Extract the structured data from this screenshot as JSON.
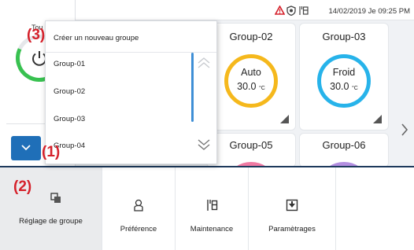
{
  "status_bar": {
    "datetime": "14/02/2019 Je 09:25 PM",
    "icons": [
      "warning-icon",
      "shield-icon",
      "maintenance-icon"
    ],
    "warning_color": "#d5212b"
  },
  "left_panel": {
    "all_label": "Tou",
    "power_ring_color": "#38c150"
  },
  "dropdown": {
    "create_label": "Créer un nouveau groupe",
    "items": [
      "Group-01",
      "Group-02",
      "Group-03",
      "Group-04"
    ],
    "scrollbar_color": "#3f8fd6"
  },
  "groups": [
    {
      "name": "Group-02",
      "mode": "Auto",
      "temp": "30.0",
      "unit": "°C",
      "ring_color": "#f5b81c"
    },
    {
      "name": "Group-03",
      "mode": "Froid",
      "temp": "30.0",
      "unit": "°C",
      "ring_color": "#27b3ea"
    },
    {
      "name": "Group-05",
      "ring_color": "#f07aa3"
    },
    {
      "name": "Group-06",
      "ring_color": "#b38ee0"
    }
  ],
  "toolbar": {
    "items": [
      {
        "label": "Réglage de groupe",
        "icon": "group-settings-icon"
      },
      {
        "label": "Préférence",
        "icon": "preference-icon"
      },
      {
        "label": "Maintenance",
        "icon": "maintenance-icon"
      },
      {
        "label": "Paramètrages",
        "icon": "settings-download-icon"
      }
    ],
    "border_color": "#1e3a5c"
  },
  "annotations": [
    "(1)",
    "(2)",
    "(3)"
  ],
  "accent_color": "#1f6fb8"
}
